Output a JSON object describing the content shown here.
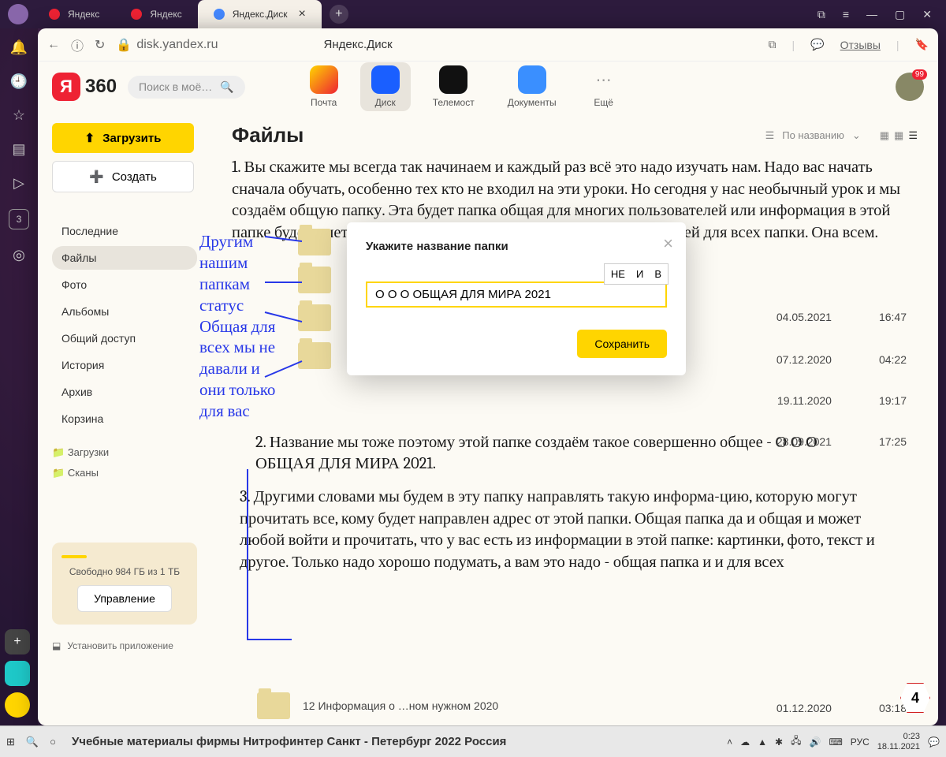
{
  "titlebar": {
    "tabs": [
      {
        "label": "Яндекс",
        "favicon": "red"
      },
      {
        "label": "Яндекс",
        "favicon": "red"
      },
      {
        "label": "Яндекс.Диск",
        "favicon": "blue",
        "active": true
      }
    ]
  },
  "address": {
    "url": "disk.yandex.ru",
    "page_title": "Яндекс.Диск",
    "reviews": "Отзывы"
  },
  "header": {
    "logo": "360",
    "logo_letter": "Я",
    "search_placeholder": "Поиск в моё…",
    "services": {
      "mail": "Почта",
      "disk": "Диск",
      "tele": "Телемост",
      "docs": "Документы",
      "more": "Ещё"
    },
    "badge": "99"
  },
  "left": {
    "upload": "Загрузить",
    "create": "Создать",
    "nav": [
      "Последние",
      "Файлы",
      "Фото",
      "Альбомы",
      "Общий доступ",
      "История",
      "Архив",
      "Корзина"
    ],
    "sub": [
      "Загрузки",
      "Сканы"
    ],
    "storage": "Свободно 984 ГБ из 1 ТБ",
    "manage": "Управление",
    "install": "Установить приложение"
  },
  "main": {
    "title": "Файлы",
    "sort": "По названию",
    "para1": "1. Вы скажите мы всегда так начинаем и каждый раз всё это надо изучать нам. Надо вас начать сначала обучать, особенно тех кто не входил на эти уроки. Но сегодня у нас необычный урок и мы создаём общую папку. Эта будет папка общая для многих пользователей или информация в этой папке будет иметь доступ для всех кому вы дадите адрес этой общей для всех папки. Она всем.",
    "para2": "2. Название мы тоже поэтому этой папке создаём такое совершенно общее - О О О ОБЩАЯ ДЛЯ МИРА 2021.",
    "para3": "3. Другими словами мы будем в эту папку направлять такую информа-цию, которую могут прочитать все, кому будет направлен адрес от этой папки. Общая папка да и общая и может любой войти и прочитать, что у вас есть из информации в этой папке: картинки, фото, текст и другое. Только надо хорошо подумать, а вам это надо - общая папка и и для всех",
    "annotation": "Другим нашим папкам статус Общая для всех мы не давали и они только для вас",
    "row_last": "12 Информация о …ном нужном 2020",
    "meta": [
      {
        "date": "04.05.2021",
        "time": "16:47"
      },
      {
        "date": "07.12.2020",
        "time": "04:22"
      },
      {
        "date": "19.11.2020",
        "time": "19:17"
      },
      {
        "date": "28.09.2021",
        "time": "17:25"
      },
      {
        "date": "01.12.2020",
        "time": "03:18"
      }
    ]
  },
  "modal": {
    "title": "Укажите название папки",
    "value": "О О О ОБЩАЯ ДЛЯ МИРА 2021",
    "ime": [
      "НЕ",
      "И",
      "В"
    ],
    "save": "Сохранить"
  },
  "page_num": "4",
  "taskbar": {
    "footer": "Учебные материалы фирмы Нитрофинтер Санкт - Петербург  2022 Россия",
    "lang": "РУС",
    "time": "0:23",
    "date": "18.11.2021"
  }
}
